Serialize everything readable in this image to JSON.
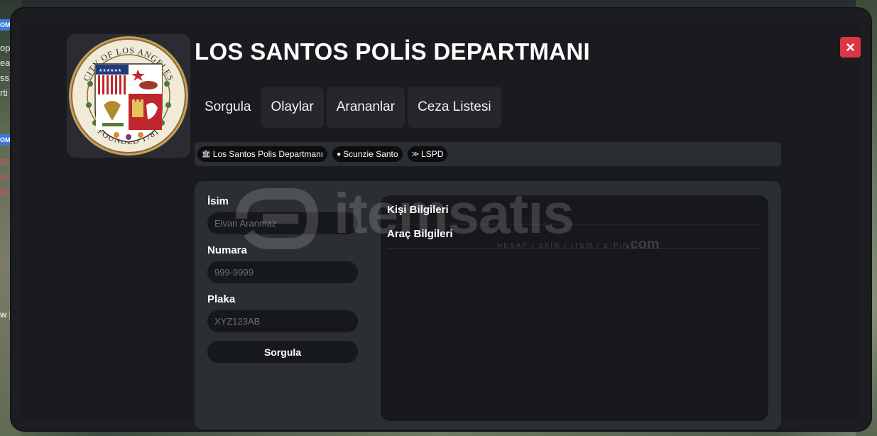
{
  "app": {
    "title": "LOS SANTOS POLİS DEPARTMANI",
    "close_icon": "×"
  },
  "logo": {
    "ring_top": "CITY OF LOS ANGELES",
    "ring_bottom": "FOUNDED 1781"
  },
  "tabs": [
    {
      "label": "Sorgula"
    },
    {
      "label": "Olaylar"
    },
    {
      "label": "Arananlar"
    },
    {
      "label": "Ceza Listesi"
    }
  ],
  "breadcrumb": [
    {
      "icon": "building-icon",
      "glyph": "🏛",
      "label": "Los Santos Polis Departmanı"
    },
    {
      "icon": "user-icon",
      "glyph": "👤",
      "label": "Scunzie Santo"
    },
    {
      "icon": "rank-icon",
      "glyph": "≫",
      "label": "LSPD"
    }
  ],
  "form": {
    "name_label": "İsim",
    "name_placeholder": "Elvan Aranmaz",
    "number_label": "Numara",
    "number_placeholder": "999-9999",
    "plate_label": "Plaka",
    "plate_placeholder": "XYZ123AB",
    "search_button": "Sorgula"
  },
  "results": [
    {
      "label": "Kişi Bilgileri"
    },
    {
      "label": "Araç Bilgileri"
    }
  ],
  "watermark": {
    "text": "itemsatıs",
    "sub": "HESAP / SKIN / ITEM / E-PIN",
    "suffix": ".com"
  },
  "background_hud": {
    "tags": [
      "OMI",
      "opp",
      "eat",
      "ss",
      "rti",
      "OMI",
      "RI",
      "e/",
      "dz",
      "w |"
    ]
  },
  "colors": {
    "window_bg": "#1c1d20",
    "panel_bg": "#2b2e33",
    "close_red": "#dc3545",
    "input_bg": "#17181b"
  }
}
